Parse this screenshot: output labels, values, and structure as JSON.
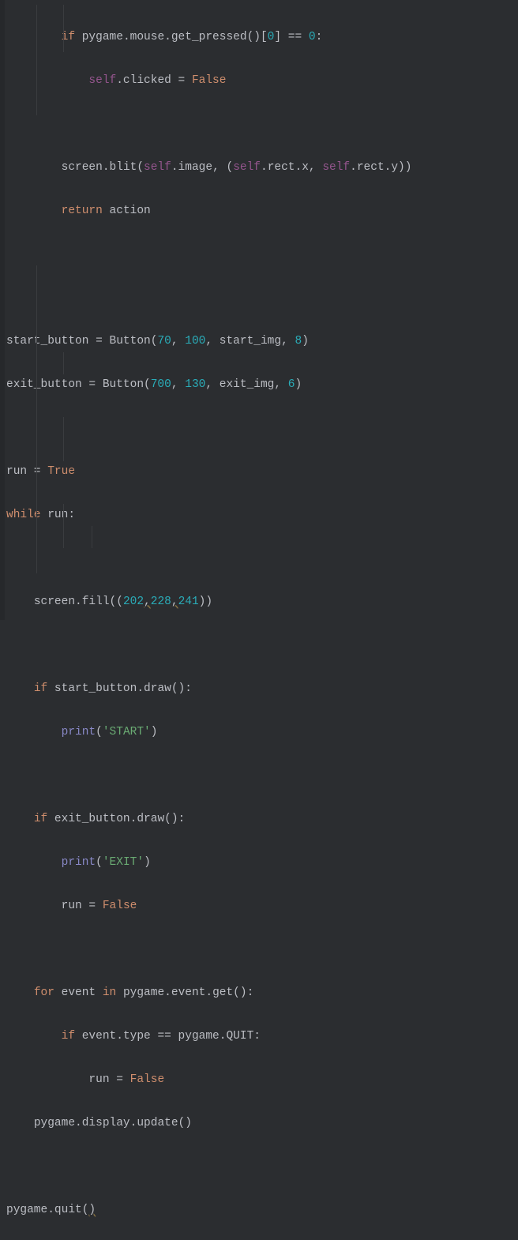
{
  "code": {
    "l1": {
      "indent": "        ",
      "kw1": "if",
      "t1": " pygame.mouse.get_pressed()[",
      "n1": "0",
      "t2": "] == ",
      "n2": "0",
      "t3": ":"
    },
    "l2": {
      "indent": "            ",
      "s1": "self",
      "t1": ".clicked = ",
      "kw1": "False"
    },
    "l3": {
      "indent": ""
    },
    "l4": {
      "indent": "        ",
      "t1": "screen.blit(",
      "s1": "self",
      "t2": ".image, (",
      "s2": "self",
      "t3": ".rect.x, ",
      "s3": "self",
      "t4": ".rect.y))"
    },
    "l5": {
      "indent": "        ",
      "kw1": "return",
      "t1": " action"
    },
    "l6": {
      "indent": ""
    },
    "l7": {
      "indent": ""
    },
    "l8": {
      "indent": "",
      "t1": "start_button = Button(",
      "n1": "70",
      "t2": ", ",
      "n2": "100",
      "t3": ", start_img, ",
      "n3": "8",
      "t4": ")"
    },
    "l9": {
      "indent": "",
      "t1": "exit_button = Button(",
      "n1": "700",
      "t2": ", ",
      "n2": "130",
      "t3": ", exit_img, ",
      "n3": "6",
      "t4": ")"
    },
    "l10": {
      "indent": ""
    },
    "l11": {
      "indent": "",
      "t1": "run = ",
      "kw1": "True"
    },
    "l12": {
      "indent": "",
      "kw1": "while",
      "t1": " run:"
    },
    "l13": {
      "indent": ""
    },
    "l14": {
      "indent": "    ",
      "t1": "screen.fill((",
      "n1": "202",
      "c1": ",",
      "n2": "228",
      "c2": ",",
      "n3": "241",
      "t2": "))"
    },
    "l15": {
      "indent": ""
    },
    "l16": {
      "indent": "    ",
      "kw1": "if",
      "t1": " start_button.draw():"
    },
    "l17": {
      "indent": "        ",
      "b1": "print",
      "t1": "(",
      "str1": "'START'",
      "t2": ")"
    },
    "l18": {
      "indent": ""
    },
    "l19": {
      "indent": "    ",
      "kw1": "if",
      "t1": " exit_button.draw():"
    },
    "l20": {
      "indent": "        ",
      "b1": "print",
      "t1": "(",
      "str1": "'EXIT'",
      "t2": ")"
    },
    "l21": {
      "indent": "        ",
      "t1": "run = ",
      "kw1": "False"
    },
    "l22": {
      "indent": ""
    },
    "l23": {
      "indent": "    ",
      "kw1": "for",
      "t1": " event ",
      "kw2": "in",
      "t2": " pygame.event.get():"
    },
    "l24": {
      "indent": "        ",
      "kw1": "if",
      "t1": " event.type == pygame.QUIT:"
    },
    "l25": {
      "indent": "            ",
      "t1": "run = ",
      "kw1": "False"
    },
    "l26": {
      "indent": "    ",
      "t1": "pygame.display.update()"
    },
    "l27": {
      "indent": ""
    },
    "l28": {
      "indent": "",
      "t1": "pygame.quit(",
      ")": ")"
    }
  }
}
